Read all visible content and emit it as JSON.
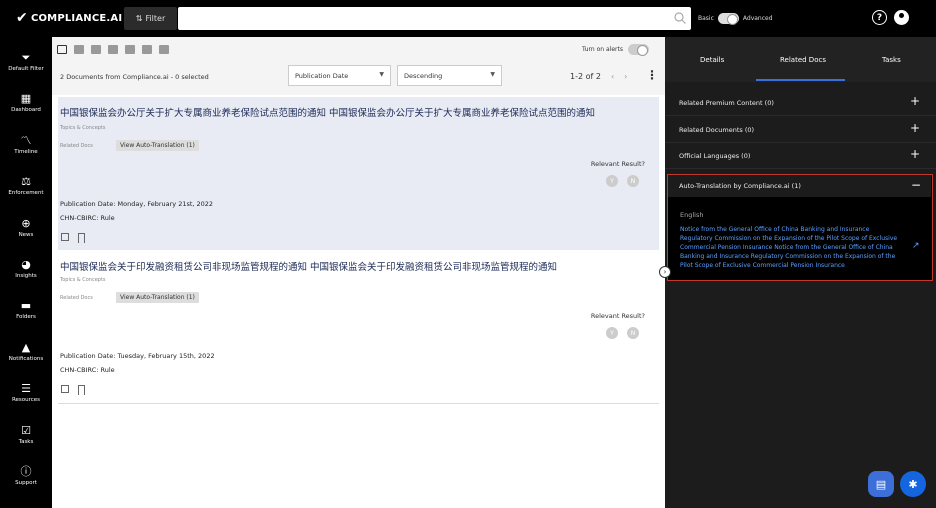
{
  "app": {
    "brand": "COMPLIANCE.AI"
  },
  "topbar": {
    "filter_label": "Filter",
    "mode_basic": "Basic",
    "mode_advanced": "Advanced",
    "help": "?"
  },
  "sidebar": {
    "items": [
      {
        "label": "Default Filter",
        "icon": "filter-icon"
      },
      {
        "label": "Dashboard",
        "icon": "dashboard-icon"
      },
      {
        "label": "Timeline",
        "icon": "timeline-icon"
      },
      {
        "label": "Enforcement",
        "icon": "enforcement-icon"
      },
      {
        "label": "News",
        "icon": "globe-icon"
      },
      {
        "label": "Insights",
        "icon": "pie-icon"
      },
      {
        "label": "Folders",
        "icon": "folder-icon"
      },
      {
        "label": "Notifications",
        "icon": "bell-icon"
      },
      {
        "label": "Resources",
        "icon": "book-icon"
      },
      {
        "label": "Tasks",
        "icon": "checkbox-icon"
      },
      {
        "label": "Support",
        "icon": "info-icon"
      }
    ]
  },
  "list": {
    "alerts_label": "Turn on alerts",
    "count_text": "2 Documents from Compliance.ai - 0 selected",
    "sort_by": "Publication Date",
    "sort_order": "Descending",
    "pagination": "1-2 of 2"
  },
  "documents": [
    {
      "title": "中国银保监会办公厅关于扩大专属商业养老保险试点范围的通知 中国银保监会办公厅关于扩大专属商业养老保险试点范围的通知",
      "topics": "Topics & Concepts",
      "related_label": "Related Docs",
      "chip": "View Auto-Translation (1)",
      "relevant": "Relevant Result?",
      "yes": "Y",
      "no": "N",
      "pub_date": "Publication Date: Monday, February 21st, 2022",
      "agency": "CHN-CBIRC:  Rule"
    },
    {
      "title": "中国银保监会关于印发融资租赁公司非现场监管规程的通知 中国银保监会关于印发融资租赁公司非现场监管规程的通知",
      "topics": "Topics & Concepts",
      "related_label": "Related Docs",
      "chip": "View Auto-Translation (1)",
      "relevant": "Relevant Result?",
      "yes": "Y",
      "no": "N",
      "pub_date": "Publication Date: Tuesday, February 15th, 2022",
      "agency": "CHN-CBIRC:  Rule"
    }
  ],
  "right_panel": {
    "tabs": [
      "Details",
      "Related Docs",
      "Tasks"
    ],
    "active_tab": "Related Docs",
    "sections": [
      {
        "label": "Related Premium Content (0)"
      },
      {
        "label": "Related Documents (0)"
      },
      {
        "label": "Official Languages (0)"
      }
    ],
    "expanded": {
      "label": "Auto-Translation by Compliance.ai (1)",
      "language": "English",
      "link_text": "Notice from the General Office of China Banking and Insurance Regulatory Commission on the Expansion of the Pilot Scope of Exclusive Commercial Pension Insurance Notice from the General Office of China Banking and Insurance Regulatory Commission on the Expansion of the Pilot Scope of Exclusive Commercial Pension Insurance"
    }
  },
  "colors": {
    "accent": "#3d6fd8",
    "link": "#5aa0ff",
    "highlight_border": "#c0392b",
    "title": "#1c2a55"
  }
}
